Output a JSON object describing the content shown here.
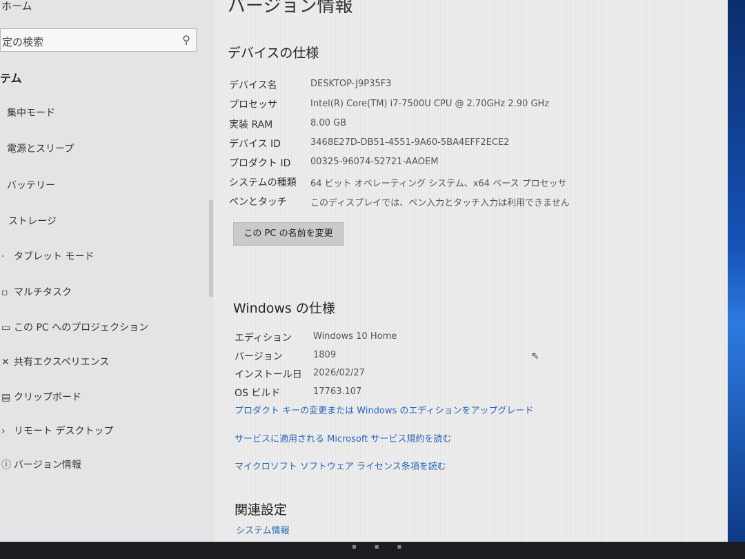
{
  "sidebar": {
    "home": "ホーム",
    "search_placeholder": "定の検索",
    "section": "テム",
    "items": [
      {
        "label": "集中モード",
        "icon": "focus-icon"
      },
      {
        "label": "電源とスリープ",
        "icon": "power-icon"
      },
      {
        "label": "バッテリー",
        "icon": "battery-icon"
      },
      {
        "label": "ストレージ",
        "icon": "storage-icon"
      },
      {
        "label": "タブレット モード",
        "icon": "tablet-icon"
      },
      {
        "label": "マルチタスク",
        "icon": "multitask-icon"
      },
      {
        "label": "この PC へのプロジェクション",
        "icon": "projection-icon"
      },
      {
        "label": "共有エクスペリエンス",
        "icon": "shared-icon"
      },
      {
        "label": "クリップボード",
        "icon": "clipboard-icon"
      },
      {
        "label": "リモート デスクトップ",
        "icon": "remote-icon"
      },
      {
        "label": "バージョン情報",
        "icon": "info-icon"
      }
    ]
  },
  "main": {
    "page_title": "バージョン情報",
    "device_specs": {
      "heading": "デバイスの仕様",
      "rows": [
        {
          "label": "デバイス名",
          "value": "DESKTOP-J9P35F3"
        },
        {
          "label": "プロセッサ",
          "value": "Intel(R) Core(TM) i7-7500U CPU @ 2.70GHz   2.90 GHz"
        },
        {
          "label": "実装 RAM",
          "value": "8.00 GB"
        },
        {
          "label": "デバイス ID",
          "value": "3468E27D-DB51-4551-9A60-5BA4EFF2ECE2"
        },
        {
          "label": "プロダクト ID",
          "value": "00325-96074-52721-AAOEM"
        },
        {
          "label": "システムの種類",
          "value": "64 ビット オペレーティング システム、x64 ベース プロセッサ"
        },
        {
          "label": "ペンとタッチ",
          "value": "このディスプレイでは、ペン入力とタッチ入力は利用できません"
        }
      ],
      "rename_button": "この PC の名前を変更"
    },
    "windows_specs": {
      "heading": "Windows の仕様",
      "rows": [
        {
          "label": "エディション",
          "value": "Windows 10 Home"
        },
        {
          "label": "バージョン",
          "value": "1809"
        },
        {
          "label": "インストール日",
          "value": "2026/02/27"
        },
        {
          "label": "OS ビルド",
          "value": "17763.107"
        }
      ],
      "links": [
        "プロダクト キーの変更または Windows のエディションをアップグレード",
        "サービスに適用される Microsoft サービス規約を読む",
        "マイクロソフト ソフトウェア ライセンス条項を読む"
      ]
    },
    "related": {
      "heading": "関連設定",
      "link": "システム情報"
    }
  }
}
